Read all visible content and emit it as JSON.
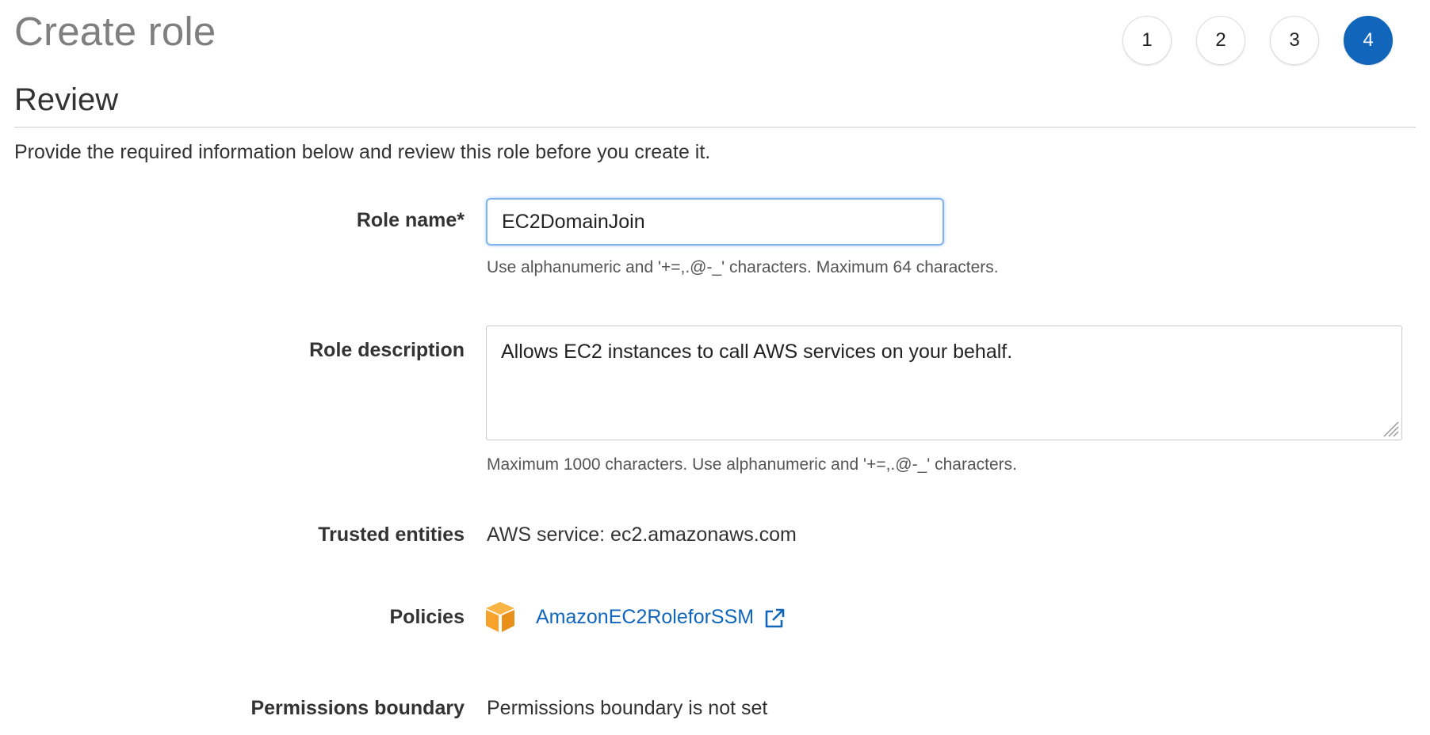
{
  "header": {
    "title": "Create role",
    "steps": [
      {
        "label": "1",
        "active": false
      },
      {
        "label": "2",
        "active": false
      },
      {
        "label": "3",
        "active": false
      },
      {
        "label": "4",
        "active": true
      }
    ]
  },
  "review": {
    "section_title": "Review",
    "intro": "Provide the required information below and review this role before you create it."
  },
  "form": {
    "role_name": {
      "label": "Role name*",
      "value": "EC2DomainJoin",
      "hint": "Use alphanumeric and '+=,.@-_' characters. Maximum 64 characters."
    },
    "role_description": {
      "label": "Role description",
      "value": "Allows EC2 instances to call AWS services on your behalf.",
      "hint": "Maximum 1000 characters. Use alphanumeric and '+=,.@-_' characters."
    },
    "trusted_entities": {
      "label": "Trusted entities",
      "value": "AWS service: ec2.amazonaws.com"
    },
    "policies": {
      "label": "Policies",
      "items": [
        {
          "name": "AmazonEC2RoleforSSM",
          "icon": "policy-box-icon",
          "link_icon": "external-link-icon"
        }
      ]
    },
    "permissions_boundary": {
      "label": "Permissions boundary",
      "value": "Permissions boundary is not set"
    }
  },
  "colors": {
    "accent": "#1166bb",
    "title_gray": "#7f7f7f",
    "policy_icon": "#f7a32b"
  }
}
